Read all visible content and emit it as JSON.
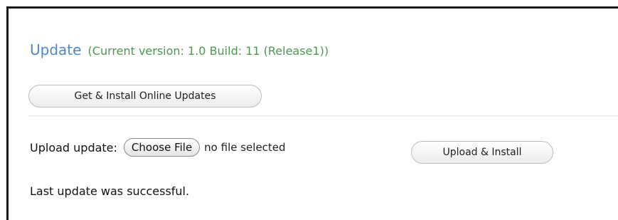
{
  "header": {
    "title": "Update",
    "version_text": "(Current version: 1.0 Build: 11 (Release1))"
  },
  "online_update": {
    "button_label": "Get & Install Online Updates"
  },
  "upload": {
    "label": "Upload update:",
    "choose_file_label": "Choose File",
    "file_status": "no file selected",
    "install_button_label": "Upload & Install"
  },
  "status": {
    "message": "Last update was successful."
  },
  "colors": {
    "title": "#4a8ac4",
    "version": "#4a9a4e",
    "frame_border": "#1a1a1a"
  }
}
